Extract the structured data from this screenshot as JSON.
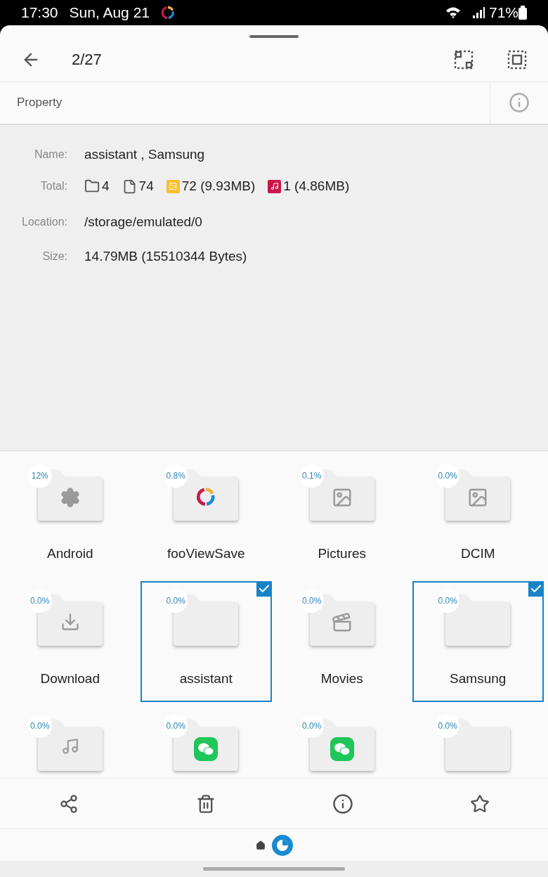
{
  "status_bar": {
    "time": "17:30",
    "date": "Sun, Aug 21",
    "battery": "71%"
  },
  "header": {
    "counter": "2/27"
  },
  "property_bar": {
    "title": "Property"
  },
  "properties": [
    {
      "kind": "text",
      "label": "Name:",
      "value": "assistant , Samsung"
    },
    {
      "kind": "totals",
      "label": "Total:",
      "items": [
        {
          "kind": "folders",
          "text": "4"
        },
        {
          "kind": "files",
          "text": "74"
        },
        {
          "kind": "images",
          "text": "72 (9.93MB)"
        },
        {
          "kind": "audio",
          "text": "1 (4.86MB)"
        }
      ]
    },
    {
      "kind": "text",
      "label": "Location:",
      "value": "/storage/emulated/0"
    },
    {
      "kind": "text",
      "label": "Size:",
      "value": "14.79MB (15510344 Bytes)"
    }
  ],
  "folders": [
    {
      "name": "Android",
      "usage": "12%",
      "kind": "settings",
      "selected": false
    },
    {
      "name": "fooViewSave",
      "usage": "0.8%",
      "kind": "app",
      "selected": false
    },
    {
      "name": "Pictures",
      "usage": "0.1%",
      "kind": "image",
      "selected": false
    },
    {
      "name": "DCIM",
      "usage": "0.0%",
      "kind": "image",
      "selected": false
    },
    {
      "name": "Download",
      "usage": "0.0%",
      "kind": "download",
      "selected": false
    },
    {
      "name": "assistant",
      "usage": "0.0%",
      "kind": "blank",
      "selected": true
    },
    {
      "name": "Movies",
      "usage": "0.0%",
      "kind": "video",
      "selected": false
    },
    {
      "name": "Samsung",
      "usage": "0.0%",
      "kind": "blank",
      "selected": true
    },
    {
      "usage": "0.0%",
      "kind": "music",
      "selected": false
    },
    {
      "usage": "0.0%",
      "kind": "chat",
      "selected": false
    },
    {
      "usage": "0.0%",
      "kind": "chat",
      "selected": false
    },
    {
      "usage": "0.0%",
      "kind": "blank",
      "selected": false
    }
  ]
}
